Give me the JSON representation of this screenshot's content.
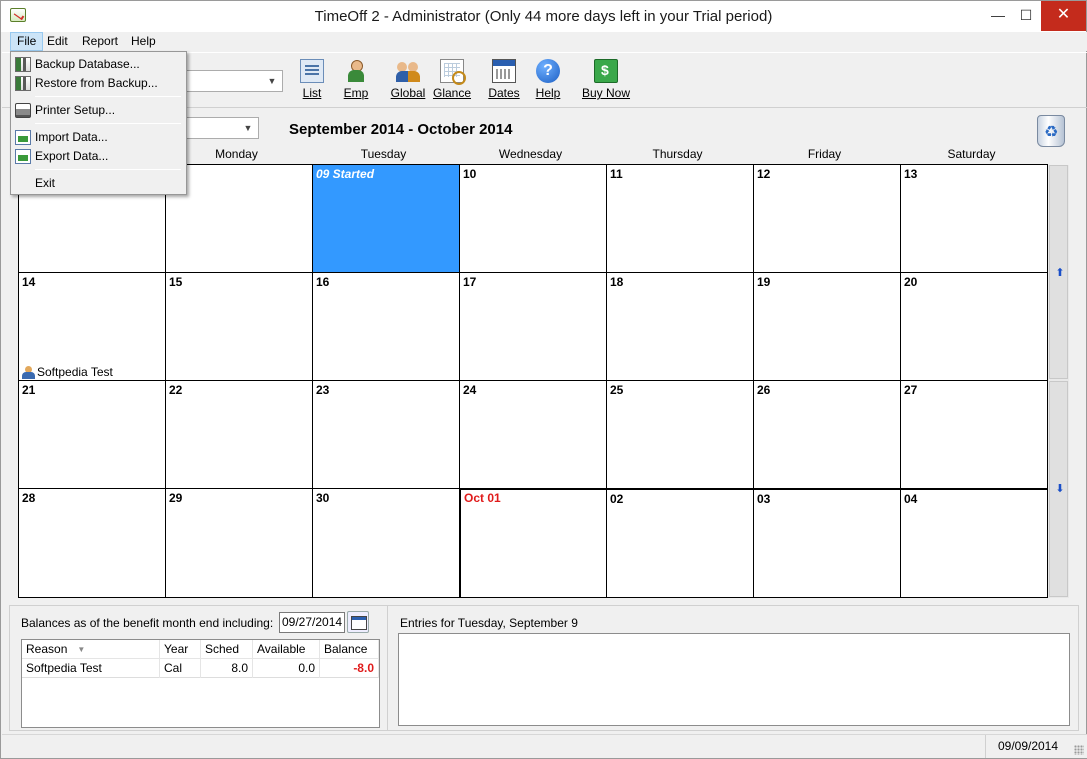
{
  "window": {
    "title": "TimeOff 2 - Administrator (Only 44 more days left in your Trial period)",
    "min_glyph": "—",
    "max_glyph": "☐",
    "close_glyph": "✕"
  },
  "menubar": {
    "file": "File",
    "edit": "Edit",
    "report": "Report",
    "help": "Help"
  },
  "file_menu": {
    "items": [
      {
        "label": "Backup Database...",
        "icon": "database-backup-icon"
      },
      {
        "label": "Restore from Backup...",
        "icon": "database-restore-icon"
      },
      {
        "label": "Printer Setup...",
        "icon": "printer-icon"
      },
      {
        "label": "Import Data...",
        "icon": "import-icon"
      },
      {
        "label": "Export Data...",
        "icon": "export-icon"
      },
      {
        "label": "Exit",
        "icon": ""
      }
    ]
  },
  "toolbar": {
    "buttons": [
      {
        "label": "List",
        "icon": "list-icon"
      },
      {
        "label": "Emp",
        "icon": "employee-icon"
      },
      {
        "label": "Global",
        "icon": "global-icon"
      },
      {
        "label": "Glance",
        "icon": "glance-icon"
      },
      {
        "label": "Dates",
        "icon": "dates-icon"
      },
      {
        "label": "Help",
        "icon": "help-icon",
        "glyph": "?"
      },
      {
        "label": "Buy Now",
        "icon": "buy-now-icon"
      }
    ]
  },
  "calendar": {
    "title": "September 2014 - October 2014",
    "days": [
      "Monday",
      "Tuesday",
      "Wednesday",
      "Thursday",
      "Friday",
      "Saturday"
    ],
    "weeks": [
      [
        {
          "num": "",
          "entry": ""
        },
        {
          "num": "",
          "entry": ""
        },
        {
          "num": "09 Started",
          "selected": true
        },
        {
          "num": "10"
        },
        {
          "num": "11"
        },
        {
          "num": "12"
        },
        {
          "num": "13"
        }
      ],
      [
        {
          "num": "14",
          "entry": "Softpedia Test"
        },
        {
          "num": "15"
        },
        {
          "num": "16"
        },
        {
          "num": "17"
        },
        {
          "num": "18"
        },
        {
          "num": "19"
        },
        {
          "num": "20"
        }
      ],
      [
        {
          "num": "21"
        },
        {
          "num": "22"
        },
        {
          "num": "23"
        },
        {
          "num": "24"
        },
        {
          "num": "25"
        },
        {
          "num": "26"
        },
        {
          "num": "27"
        }
      ],
      [
        {
          "num": "28"
        },
        {
          "num": "29"
        },
        {
          "num": "30"
        },
        {
          "num": "Oct 01",
          "red": true
        },
        {
          "num": "02"
        },
        {
          "num": "03"
        },
        {
          "num": "04"
        }
      ]
    ],
    "scroll_up_glyph": "⬆",
    "scroll_down_glyph": "⬇"
  },
  "balances": {
    "label": "Balances as of the benefit month end including:",
    "date_value": "09/27/2014",
    "columns": [
      "Reason",
      "Year",
      "Sched",
      "Available",
      "Balance"
    ],
    "rows": [
      {
        "reason": "Softpedia Test",
        "year": "Cal",
        "sched": "8.0",
        "available": "0.0",
        "balance": "-8.0"
      }
    ]
  },
  "entries": {
    "label": "Entries for Tuesday,  September 9"
  },
  "status": {
    "date": "09/09/2014"
  },
  "colors": {
    "selected_day": "#3399ff",
    "negative": "#e01b1b",
    "close_button": "#c42b1c"
  }
}
